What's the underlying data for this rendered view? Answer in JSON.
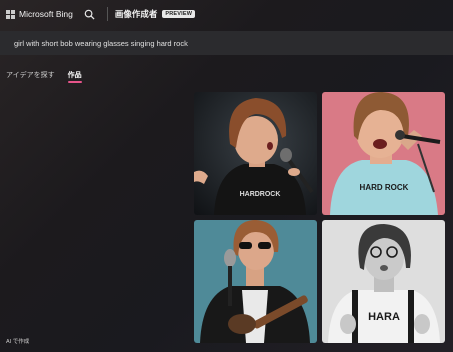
{
  "header": {
    "brand": "Microsoft Bing",
    "product": "画像作成者",
    "badge": "PREVIEW"
  },
  "prompt": {
    "text": "girl with short bob wearing glasses singing hard rock"
  },
  "tabs": [
    {
      "label": "アイデアを探す",
      "active": false
    },
    {
      "label": "作品",
      "active": true
    }
  ],
  "images": [
    {
      "shirt_text": "HARDROCK"
    },
    {
      "shirt_text": "HARD ROCK"
    },
    {
      "shirt_text": ""
    },
    {
      "shirt_text": "HARA"
    }
  ],
  "footer": {
    "text": "AI で作成"
  },
  "colors": {
    "accent": "#e6548a",
    "prompt_bg": "#2b2b2e"
  }
}
